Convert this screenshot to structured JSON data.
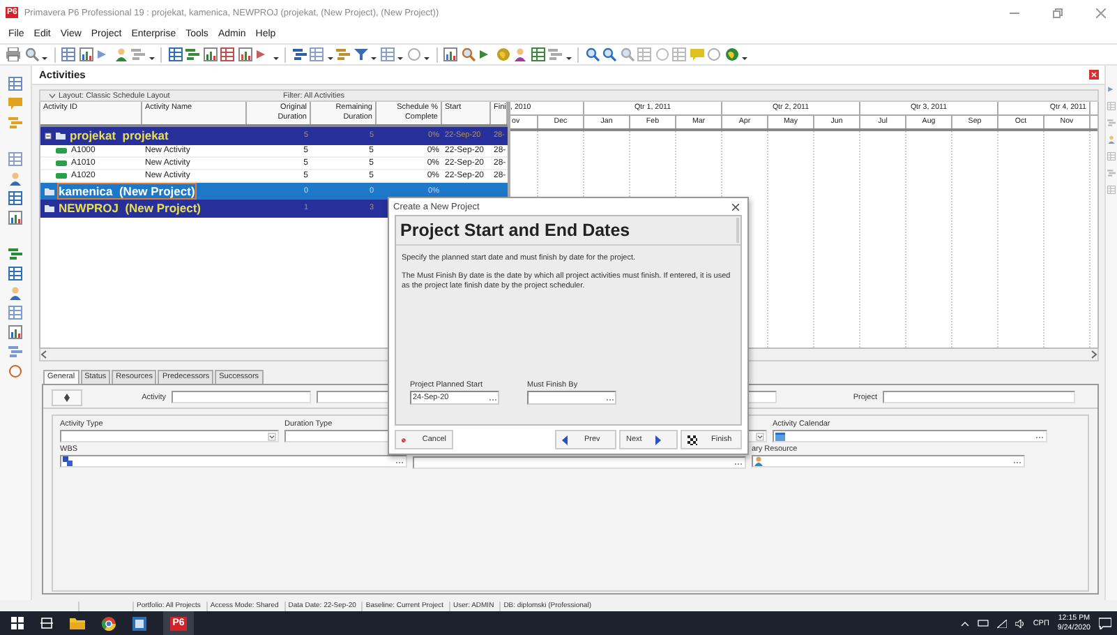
{
  "window": {
    "logo": "P6",
    "title": "Primavera P6 Professional 19 : projekat, kamenica, NEWPROJ (projekat, (New Project), (New Project))"
  },
  "menu": [
    "File",
    "Edit",
    "View",
    "Project",
    "Enterprise",
    "Tools",
    "Admin",
    "Help"
  ],
  "activities": {
    "title": "Activities",
    "layout": "Layout: Classic Schedule Layout",
    "filter": "Filter: All Activities",
    "columns": [
      "Activity ID",
      "Activity Name",
      "Original Duration",
      "Remaining Duration",
      "Schedule % Complete",
      "Start",
      "Fini"
    ],
    "rows": [
      {
        "kind": "project",
        "selected": false,
        "expanded": true,
        "cells": [
          "projekat  projekat",
          "",
          "5",
          "5",
          "0%",
          "22-Sep-20",
          "28-"
        ]
      },
      {
        "kind": "activity",
        "selected": false,
        "cells": [
          "A1000",
          "New Activity",
          "5",
          "5",
          "0%",
          "22-Sep-20",
          "28-"
        ]
      },
      {
        "kind": "activity",
        "selected": false,
        "cells": [
          "A1010",
          "New Activity",
          "5",
          "5",
          "0%",
          "22-Sep-20",
          "28-"
        ]
      },
      {
        "kind": "activity",
        "selected": false,
        "cells": [
          "A1020",
          "New Activity",
          "5",
          "5",
          "0%",
          "22-Sep-20",
          "28-"
        ]
      },
      {
        "kind": "project",
        "selected": true,
        "cells": [
          "kamenica  (New Project)",
          "",
          "0",
          "0",
          "0%"
        ]
      },
      {
        "kind": "project",
        "selected": false,
        "cells": [
          "NEWPROJ  (New Project)",
          "",
          "1",
          "3"
        ]
      }
    ],
    "timescale": [
      {
        "label": ", 2010",
        "months": [
          "ov",
          "Dec"
        ]
      },
      {
        "label": "Qtr 1, 2011",
        "months": [
          "Jan",
          "Feb",
          "Mar"
        ]
      },
      {
        "label": "Qtr 2, 2011",
        "months": [
          "Apr",
          "May",
          "Jun"
        ]
      },
      {
        "label": "Qtr 3, 2011",
        "months": [
          "Jul",
          "Aug",
          "Sep"
        ]
      },
      {
        "label": "Qtr 4, 2011",
        "months": [
          "Oct",
          "Nov"
        ]
      }
    ]
  },
  "details": {
    "tabs": [
      {
        "label": "General",
        "selected": true
      },
      {
        "label": "Status",
        "selected": false
      },
      {
        "label": "Resources",
        "selected": false
      },
      {
        "label": "Predecessors",
        "selected": false
      },
      {
        "label": "Successors",
        "selected": false
      }
    ],
    "labels": {
      "activity": "Activity",
      "project": "Project",
      "activity_type": "Activity Type",
      "duration_type": "Duration Type",
      "activity_calendar": "Activity Calendar",
      "wbs": "WBS",
      "resource": "ary Resource"
    }
  },
  "dialog": {
    "title": "Create a New Project",
    "heading": "Project Start and End Dates",
    "paragraphs": [
      "Specify the planned start date and must finish by date for the project.",
      "The Must Finish By date is the date by which all project activities must finish.  If entered, it is used as the project late finish date by the project scheduler."
    ],
    "fields": [
      {
        "label": "Project Planned Start",
        "value": "24-Sep-20"
      },
      {
        "label": "Must Finish By"
      }
    ],
    "buttons": [
      {
        "kind": "cancel",
        "label": "Cancel"
      },
      {
        "kind": "prev",
        "label": "Prev"
      },
      {
        "kind": "next",
        "label": "Next"
      },
      {
        "kind": "finish",
        "label": "Finish"
      }
    ]
  },
  "status_bar": [
    "Portfolio: All Projects",
    "Access Mode: Shared",
    "Data Date: 22-Sep-20",
    "Baseline: Current Project",
    "User: ADMIN",
    "DB: diplomski (Professional)"
  ],
  "taskbar": {
    "active_app": "P6",
    "language": "СРП",
    "time": "12:15 PM",
    "date": "9/24/2020"
  }
}
